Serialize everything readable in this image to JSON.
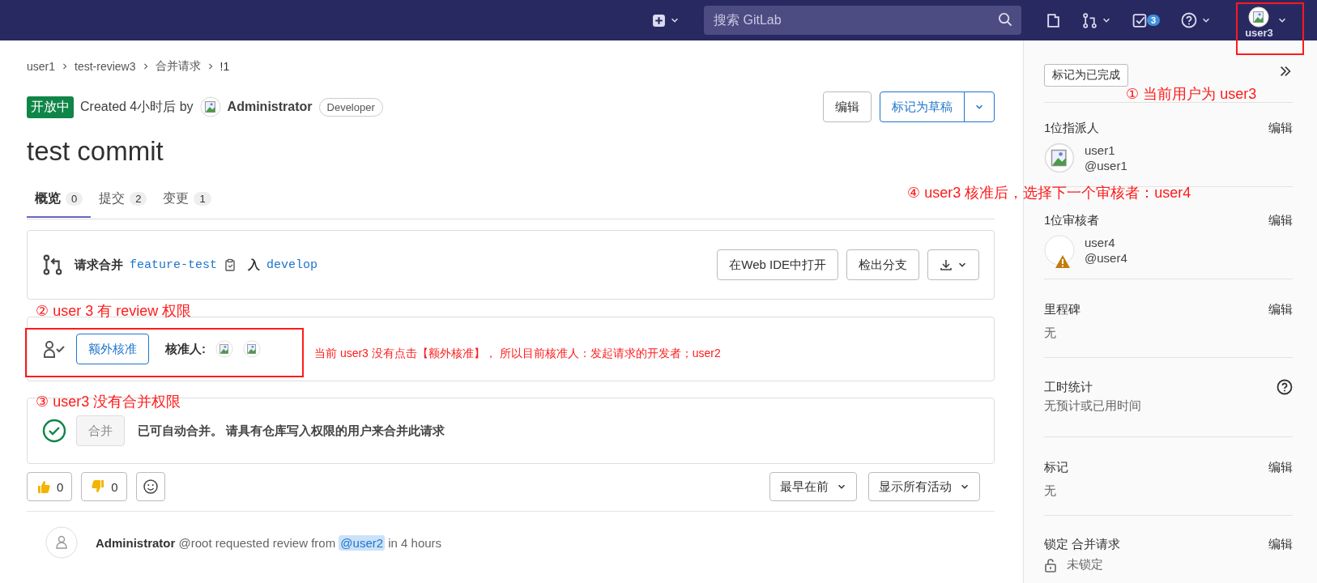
{
  "header": {
    "search": {
      "placeholder": "搜索 GitLab"
    },
    "todo_count": "3",
    "user": "user3"
  },
  "breadcrumbs": [
    "user1",
    "test-review3",
    "合并请求",
    "!1"
  ],
  "merge_request": {
    "status": "开放中",
    "created": "Created 4小时后 by",
    "author": "Administrator",
    "role": "Developer",
    "title": "test commit",
    "edit_button": "编辑",
    "draft_button": "标记为草稿"
  },
  "tabs": [
    {
      "label": "概览",
      "count": "0",
      "selected": true
    },
    {
      "label": "提交",
      "count": "2",
      "selected": false
    },
    {
      "label": "变更",
      "count": "1",
      "selected": false
    }
  ],
  "branch": {
    "label": "请求合并",
    "source": "feature-test",
    "into": "入",
    "target": "develop",
    "buttons": [
      "在Web IDE中打开",
      "检出分支"
    ]
  },
  "approval": {
    "button": "额外核准",
    "label": "核准人:"
  },
  "merge": {
    "button": "合并",
    "disabled": true,
    "message": "已可自动合并。 请具有仓库写入权限的用户来合并此请求"
  },
  "reactions": [
    {
      "kind": "thumbs-up",
      "count": "0"
    },
    {
      "kind": "thumbs-down",
      "count": "0"
    }
  ],
  "sort": "最早在前",
  "filter": "显示所有活动",
  "activity": {
    "author": "Administrator",
    "handle": "@root",
    "text": "requested review from",
    "mention": "@user2",
    "time": "in 4 hours"
  },
  "sidebar": {
    "todo_button": "标记为已完成",
    "sections": [
      {
        "kind": "users",
        "title": "1位指派人",
        "action": "编辑",
        "users": [
          {
            "name": "user1",
            "handle": "@user1",
            "warning": false
          }
        ]
      },
      {
        "kind": "users",
        "title": "1位审核者",
        "action": "编辑",
        "users": [
          {
            "name": "user4",
            "handle": "@user4",
            "warning": true
          }
        ]
      },
      {
        "kind": "value",
        "title": "里程碑",
        "action": "编辑",
        "value": "无"
      },
      {
        "kind": "help",
        "title": "工时统计",
        "value": "无预计或已用时间"
      },
      {
        "kind": "value",
        "title": "标记",
        "action": "编辑",
        "value": "无"
      },
      {
        "kind": "lock",
        "title": "锁定 合并请求",
        "action": "编辑",
        "value": "未锁定"
      }
    ]
  },
  "annotations": [
    "① 当前用户为 user3",
    "② user 3 有 review 权限",
    "③ user3 没有合并权限",
    "④ user3 核准后，选择下一个审核者：user4",
    "当前 user3 没有点击【额外核准】， 所以目前核准人：发起请求的开发者；user2"
  ]
}
